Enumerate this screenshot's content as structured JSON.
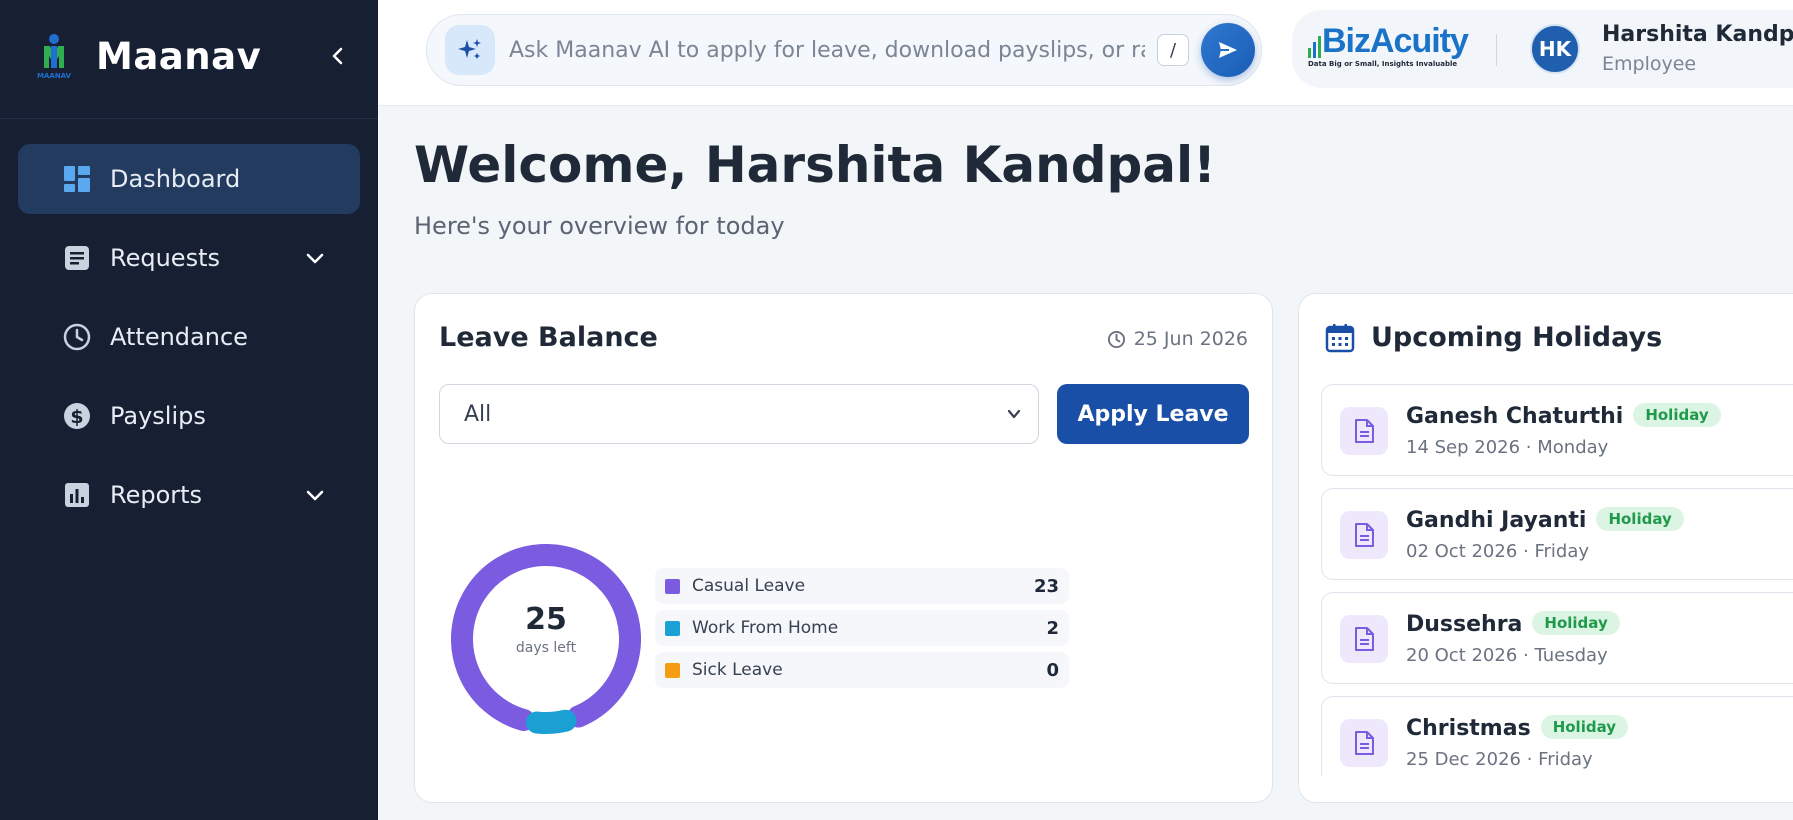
{
  "app": {
    "name": "Maanav",
    "logo_caption": "MAANAV"
  },
  "sidebar": {
    "items": [
      {
        "label": "Dashboard",
        "icon": "dashboard-icon",
        "active": true
      },
      {
        "label": "Requests",
        "icon": "document-icon",
        "has_children": true
      },
      {
        "label": "Attendance",
        "icon": "clock-icon"
      },
      {
        "label": "Payslips",
        "icon": "dollar-icon"
      },
      {
        "label": "Reports",
        "icon": "bar-chart-icon",
        "has_children": true
      }
    ]
  },
  "search": {
    "placeholder": "Ask Maanav AI to apply for leave, download payslips, or raise a request",
    "shortcut": "/"
  },
  "company": {
    "name": "BizAcuity",
    "tagline": "Data Big or Small, Insights Invaluable"
  },
  "user": {
    "initials": "HK",
    "name": "Harshita Kandpal",
    "role": "Employee"
  },
  "main": {
    "welcome": "Welcome, Harshita Kandpal!",
    "subtitle": "Here's your overview for today"
  },
  "leave_balance": {
    "title": "Leave Balance",
    "date": "25 Jun 2026",
    "filter_value": "All",
    "apply_label": "Apply Leave",
    "total": "25",
    "total_caption": "days left",
    "types": [
      {
        "name": "Casual Leave",
        "value": "23",
        "color": "#7b5ce0"
      },
      {
        "name": "Work From Home",
        "value": "2",
        "color": "#1ba0d4"
      },
      {
        "name": "Sick Leave",
        "value": "0",
        "color": "#f59d12"
      }
    ]
  },
  "holidays": {
    "title": "Upcoming Holidays",
    "badge": "Holiday",
    "items": [
      {
        "name": "Ganesh Chaturthi",
        "date": "14 Sep 2026 · Monday"
      },
      {
        "name": "Gandhi Jayanti",
        "date": "02 Oct 2026 · Friday"
      },
      {
        "name": "Dussehra",
        "date": "20 Oct 2026 · Tuesday"
      },
      {
        "name": "Christmas",
        "date": "25 Dec 2026 · Friday"
      }
    ]
  }
}
